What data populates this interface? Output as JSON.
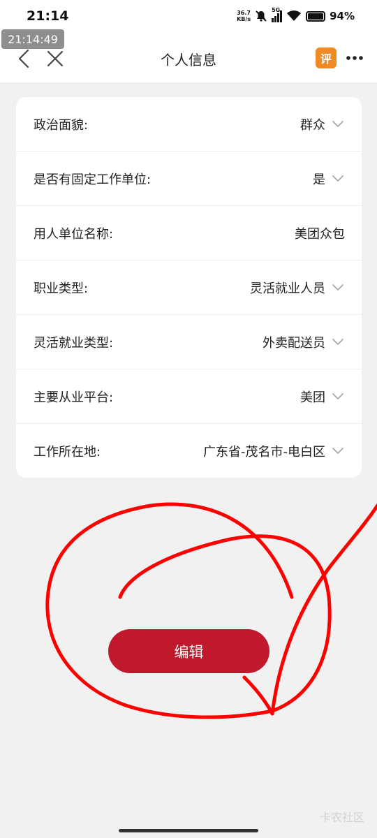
{
  "status_bar": {
    "time": "21:14",
    "net_speed_value": "36.7",
    "net_speed_unit": "KB/s",
    "network": "5G",
    "battery": "94%"
  },
  "timestamp_overlay": "21:14:49",
  "nav": {
    "title": "个人信息",
    "eval_badge": "评"
  },
  "rows": [
    {
      "label": "政治面貌:",
      "value": "群众",
      "has_dropdown": true
    },
    {
      "label": "是否有固定工作单位:",
      "value": "是",
      "has_dropdown": true
    },
    {
      "label": "用人单位名称:",
      "value": "美团众包",
      "has_dropdown": false
    },
    {
      "label": "职业类型:",
      "value": "灵活就业人员",
      "has_dropdown": true
    },
    {
      "label": "灵活就业类型:",
      "value": "外卖配送员",
      "has_dropdown": true
    },
    {
      "label": "主要从业平台:",
      "value": "美团",
      "has_dropdown": true
    },
    {
      "label": "工作所在地:",
      "value": "广东省-茂名市-电白区",
      "has_dropdown": true
    }
  ],
  "edit_button_label": "编辑",
  "watermark": "卡农社区",
  "colors": {
    "accent": "#c0192b",
    "scribble": "#ff0000",
    "background": "#f1f1f1"
  }
}
